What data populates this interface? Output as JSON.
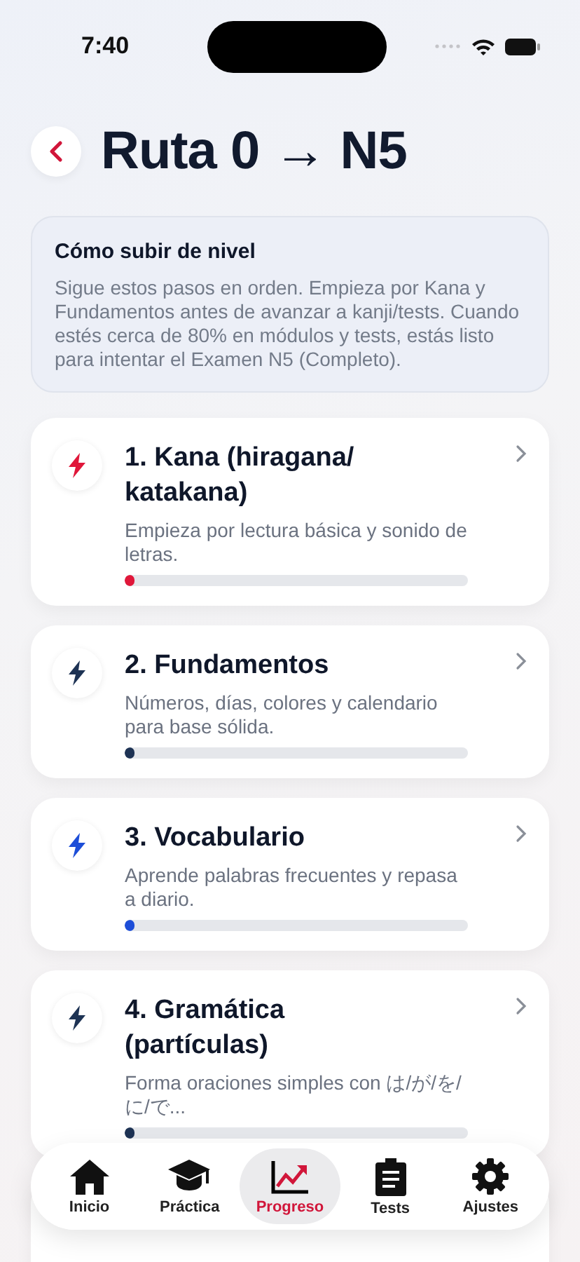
{
  "status_bar": {
    "time": "7:40"
  },
  "header": {
    "title": "Ruta 0 → N5"
  },
  "info": {
    "title": "Cómo subir de nivel",
    "text": "Sigue estos pasos en orden. Empieza por Kana y Fundamentos antes de avanzar a kanji/tests. Cuando estés cerca de 80% en módulos y tests, estás listo para intentar el Examen N5 (Completo)."
  },
  "steps": [
    {
      "title": "1. Kana (hiragana/ katakana)",
      "description": "Empieza por lectura básica y sonido de letras.",
      "color": "#e0173a",
      "level": 0.03
    },
    {
      "title": "2. Fundamentos",
      "description": "Números, días, colores y calendario para base sólida.",
      "color": "#1e3354",
      "level": 0.03
    },
    {
      "title": "3. Vocabulario",
      "description": "Aprende palabras frecuentes y repasa a diario.",
      "color": "#1d4ed8",
      "level": 0.03
    },
    {
      "title": "4. Gramática (partículas)",
      "description": "Forma oraciones simples con は/が/を/に/で...",
      "color": "#1e3354",
      "level": 0.03
    }
  ],
  "tab_bar": [
    {
      "label": "Inicio",
      "kind": "home",
      "selected": false
    },
    {
      "label": "Práctica",
      "kind": "cap",
      "selected": false
    },
    {
      "label": "Progreso",
      "kind": "chart",
      "selected": true
    },
    {
      "label": "Tests",
      "kind": "clipboard",
      "selected": false
    },
    {
      "label": "Ajustes",
      "kind": "gear",
      "selected": false
    }
  ]
}
